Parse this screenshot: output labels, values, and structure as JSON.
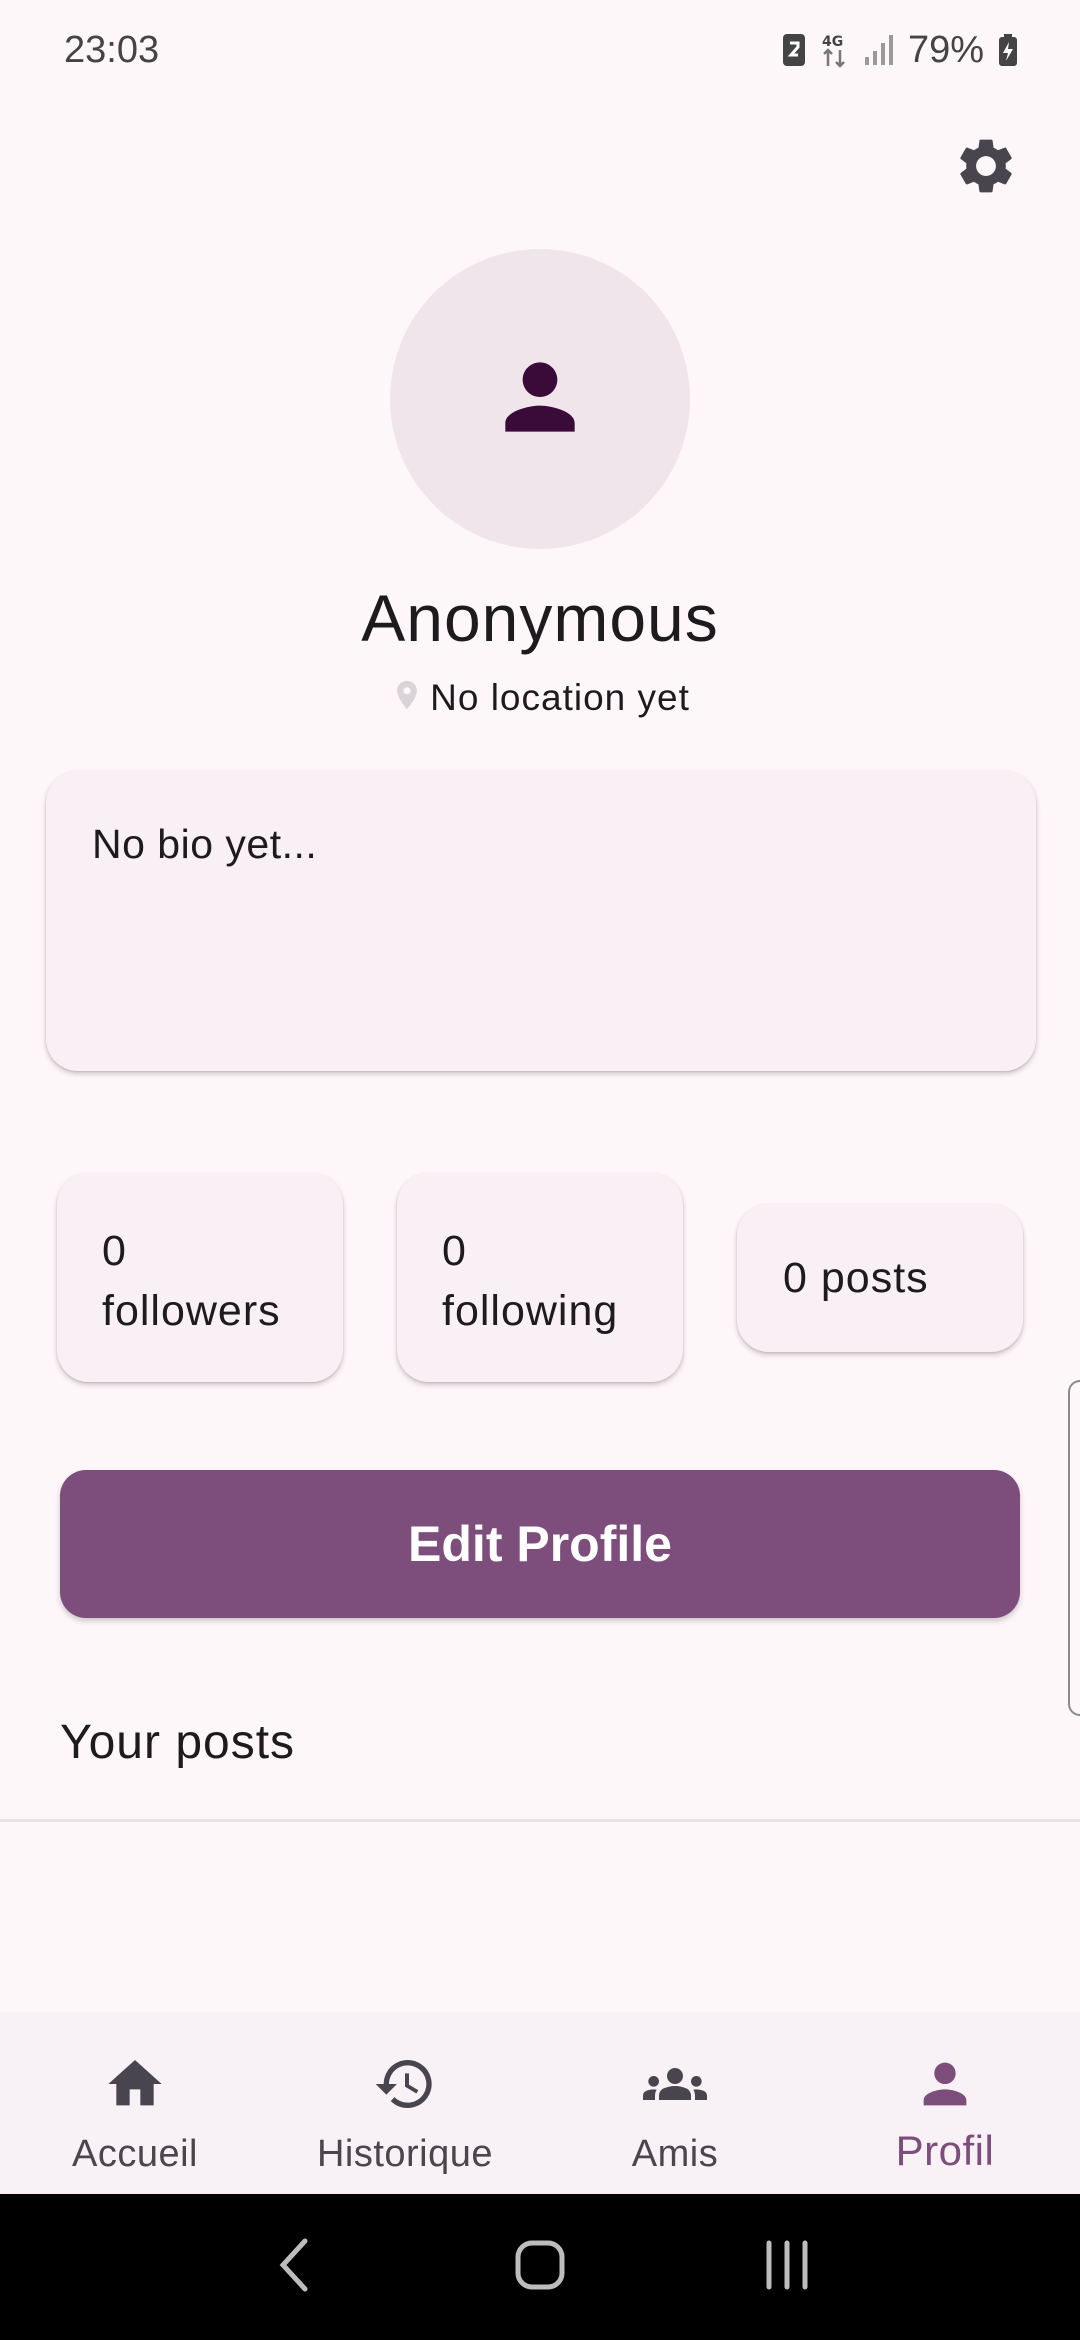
{
  "status_bar": {
    "time": "23:03",
    "network": "4G",
    "battery": "79%"
  },
  "profile": {
    "name": "Anonymous",
    "location": "No location yet",
    "bio": "No bio yet..."
  },
  "stats": {
    "followers_count": "0",
    "followers_label": "followers",
    "following_count": "0",
    "following_label": "following",
    "posts": "0 posts"
  },
  "actions": {
    "edit_profile": "Edit Profile"
  },
  "posts_section": {
    "title": "Your posts"
  },
  "bottom_nav": {
    "items": [
      {
        "label": "Accueil",
        "icon": "home-icon"
      },
      {
        "label": "Historique",
        "icon": "history-icon"
      },
      {
        "label": "Amis",
        "icon": "group-icon"
      },
      {
        "label": "Profil",
        "icon": "person-icon",
        "active": true
      }
    ]
  },
  "colors": {
    "background": "#FEF7FA",
    "primary": "#7D4E7C",
    "avatar_bg": "#EFE5EB",
    "avatar_icon": "#3A0A38",
    "card_bg": "#F8F0F5"
  }
}
